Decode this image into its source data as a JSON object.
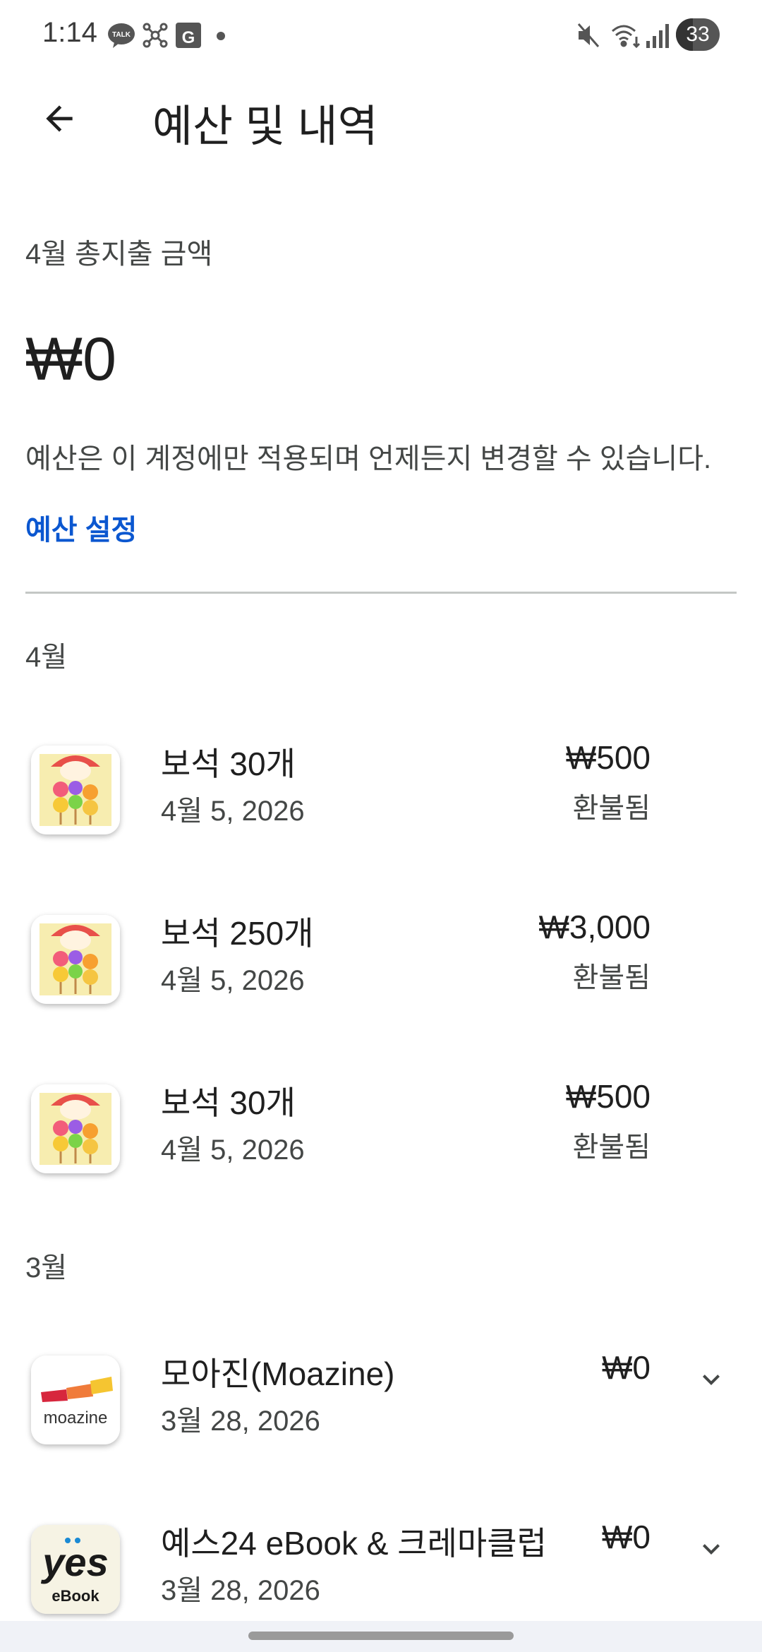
{
  "status_bar": {
    "time": "1:14",
    "left_icons": [
      "kakaotalk-icon",
      "network-hub-icon",
      "calendar-app-icon",
      "notification-dot-icon"
    ],
    "right_icons": [
      "mute-icon",
      "wifi-icon",
      "signal-icon"
    ],
    "battery": "33"
  },
  "header": {
    "title": "예산 및 내역",
    "back_icon": "arrow-back-icon"
  },
  "summary": {
    "label": "4월 총지출 금액",
    "amount": "₩0",
    "note": "예산은 이 계정에만 적용되며 언제든지 변경할 수 있습니다.",
    "budget_link": "예산 설정"
  },
  "colors": {
    "link": "#0b57d0",
    "divider": "#c4c7c5",
    "text_primary": "#1f1f1f",
    "text_secondary": "#444746"
  },
  "groups": [
    {
      "month": "4월",
      "items": [
        {
          "title": "보석 30개",
          "date": "4월 5, 2026",
          "price": "₩500",
          "status": "환불됨",
          "icon": "dango-game-icon"
        },
        {
          "title": "보석 250개",
          "date": "4월 5, 2026",
          "price": "₩3,000",
          "status": "환불됨",
          "icon": "dango-game-icon"
        },
        {
          "title": "보석 30개",
          "date": "4월 5, 2026",
          "price": "₩500",
          "status": "환불됨",
          "icon": "dango-game-icon"
        }
      ]
    },
    {
      "month": "3월",
      "items": [
        {
          "title": "모아진(Moazine)",
          "date": "3월 28, 2026",
          "price": "₩0",
          "icon": "moazine-app-icon",
          "icon_text": "moazine",
          "expandable": true
        },
        {
          "title": "예스24 eBook & 크레마클럽",
          "date": "3월 28, 2026",
          "price": "₩0",
          "icon": "yes24-ebook-icon",
          "icon_text": "yes",
          "icon_subtext": "eBook",
          "expandable": true
        }
      ]
    }
  ]
}
